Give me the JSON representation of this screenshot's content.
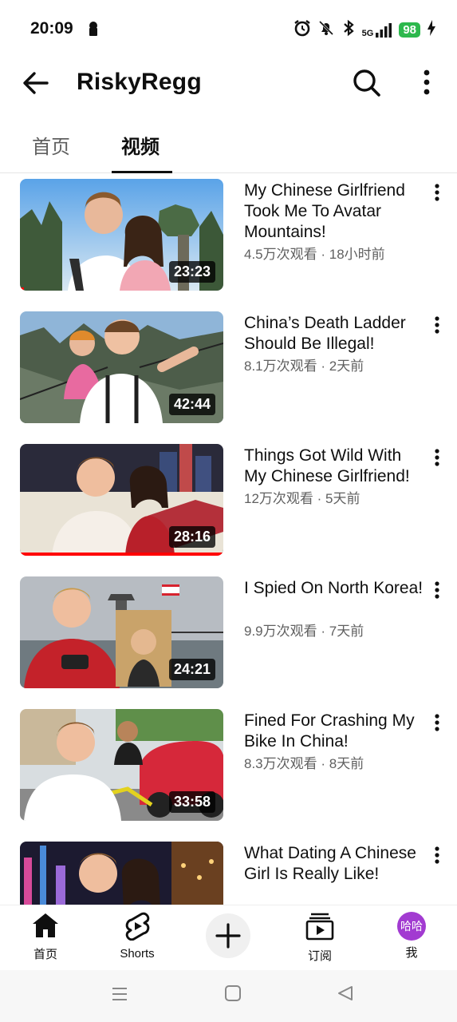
{
  "status_bar": {
    "time": "20:09",
    "network": "5G",
    "battery": "98"
  },
  "header": {
    "title": "RiskyRegg"
  },
  "tabs": [
    {
      "label": "首页"
    },
    {
      "label": "视频"
    }
  ],
  "videos": [
    {
      "title": "My Chinese Girlfriend Took Me To Avatar Mountains!",
      "meta": "4.5万次观看 · 18小时前",
      "duration": "23:23",
      "progress": 0.02
    },
    {
      "title": "China’s Death Ladder Should Be Illegal!",
      "meta": "8.1万次观看 · 2天前",
      "duration": "42:44",
      "progress": 0
    },
    {
      "title": "Things Got Wild With My Chinese Girlfriend!",
      "meta": "12万次观看 · 5天前",
      "duration": "28:16",
      "progress": 1.0
    },
    {
      "title": "I Spied On North Korea!",
      "meta": "9.9万次观看 · 7天前",
      "duration": "24:21",
      "progress": 0
    },
    {
      "title": "Fined For Crashing My Bike In China!",
      "meta": "8.3万次观看 · 8天前",
      "duration": "33:58",
      "progress": 0
    },
    {
      "title": "What Dating A Chinese Girl Is Really Like!",
      "meta": "",
      "duration": "",
      "progress": 0
    }
  ],
  "bottom_nav": {
    "home": "首页",
    "shorts": "Shorts",
    "subscriptions": "订阅",
    "you": "我",
    "avatar_text": "哈哈"
  },
  "colors": {
    "accent": "#ff0000",
    "avatar": "#a23bd1",
    "battery": "#2db84d"
  }
}
